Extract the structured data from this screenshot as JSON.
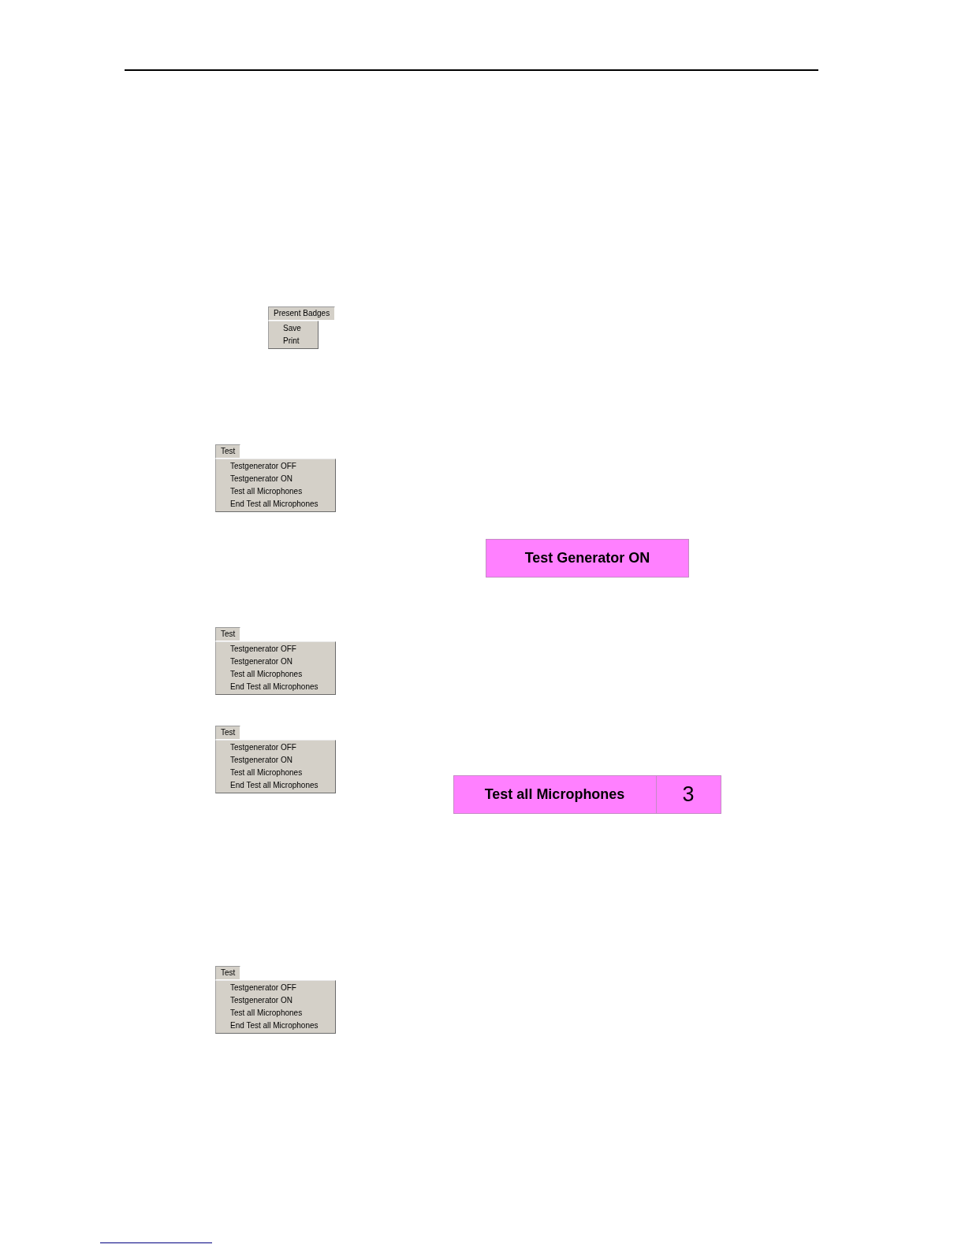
{
  "figures": [
    {
      "kind": "menu",
      "title": "Present Badges",
      "items": [
        "Save",
        "Print"
      ]
    },
    {
      "kind": "menu",
      "title": "Test",
      "items": [
        "Testgenerator OFF",
        "Testgenerator ON",
        "Test all Microphones",
        "End Test all Microphones"
      ]
    },
    {
      "kind": "indicator",
      "label": "Test Generator ON"
    },
    {
      "kind": "menu",
      "title": "Test",
      "items": [
        "Testgenerator OFF",
        "Testgenerator ON",
        "Test all Microphones",
        "End Test all Microphones"
      ]
    },
    {
      "kind": "menu",
      "title": "Test",
      "items": [
        "Testgenerator OFF",
        "Testgenerator ON",
        "Test all Microphones",
        "End Test all Microphones"
      ]
    },
    {
      "kind": "indicator",
      "label": "Test all Microphones",
      "count": "3"
    },
    {
      "kind": "menu",
      "title": "Test",
      "items": [
        "Testgenerator OFF",
        "Testgenerator ON",
        "Test all Microphones",
        "End Test all Microphones"
      ]
    }
  ]
}
